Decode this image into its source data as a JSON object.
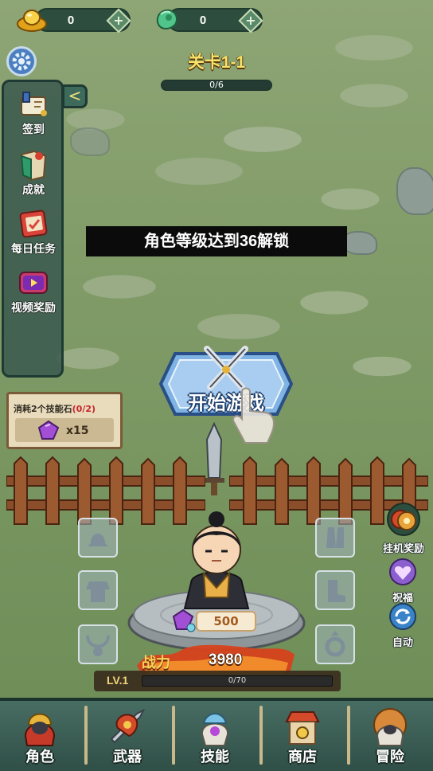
{
  "currency": {
    "gold": {
      "value": "0",
      "plus": "+"
    },
    "jade": {
      "value": "0",
      "plus": "+"
    }
  },
  "stage": {
    "title": "关卡1-1",
    "progress_text": "0/6",
    "progress_fraction": 0
  },
  "side_menu": {
    "collapse_arrow": "<",
    "items": [
      {
        "label": "签到",
        "icon": "sign-in-scroll-icon"
      },
      {
        "label": "成就",
        "icon": "achievement-book-icon"
      },
      {
        "label": "每日任务",
        "icon": "daily-task-icon"
      },
      {
        "label": "视频奖励",
        "icon": "video-reward-icon"
      }
    ]
  },
  "unlock_banner": "角色等级达到36解锁",
  "start_button": {
    "label": "开始游戏"
  },
  "skill_stone": {
    "cost_prefix": "消耗2个技能石",
    "cost_progress": "(0/2)",
    "quantity": "x15"
  },
  "right_buttons": [
    {
      "label": "挂机奖励",
      "icon": "idle-reward-coins-icon"
    },
    {
      "label": "祝福",
      "icon": "blessing-heart-icon"
    },
    {
      "label": "自动",
      "icon": "auto-refresh-icon"
    }
  ],
  "hero": {
    "upgrade_cost": "500",
    "power_label": "战力",
    "power_value": "3980",
    "level_label": "LV.1",
    "exp_text": "0/70",
    "exp_fraction": 0
  },
  "equipment_slots": [
    "helmet-slot",
    "armor-slot",
    "necklace-slot",
    "gloves-slot",
    "boots-slot",
    "ring-slot"
  ],
  "bottom_nav": [
    {
      "label": "角色",
      "icon": "character-icon"
    },
    {
      "label": "武器",
      "icon": "weapon-icon"
    },
    {
      "label": "技能",
      "icon": "skill-icon"
    },
    {
      "label": "商店",
      "icon": "shop-icon"
    },
    {
      "label": "冒险",
      "icon": "adventure-icon"
    }
  ],
  "colors": {
    "accent_gold": "#f7e36a",
    "panel_green": "#3a584e",
    "button_blue": "#6b9fd6",
    "banner_black": "#0b0b0b"
  }
}
